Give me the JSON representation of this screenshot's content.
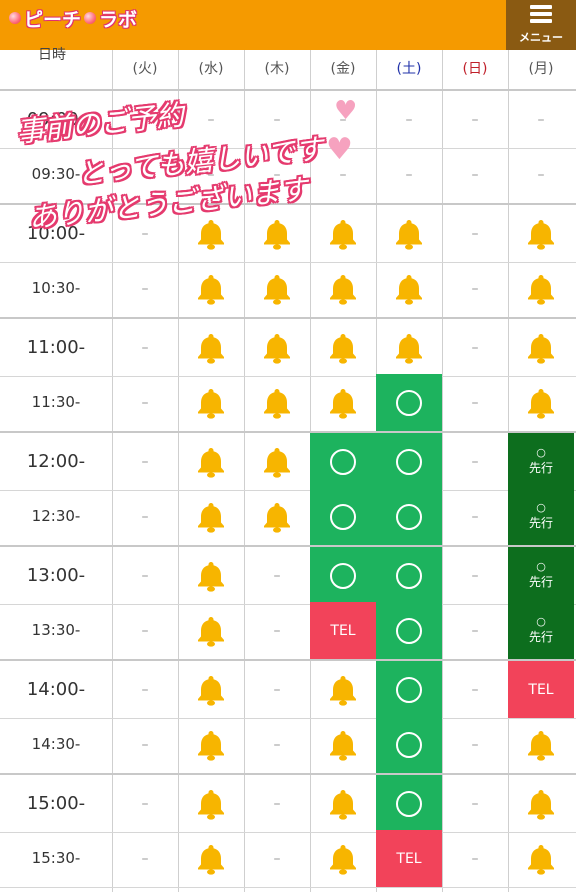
{
  "header": {
    "logo_left": "ピーチ",
    "logo_right": "ラボ",
    "menu_label": "メニュー"
  },
  "table": {
    "time_col_head": "日時",
    "days": [
      "(火)",
      "(水)",
      "(木)",
      "(金)",
      "(土)",
      "(日)",
      "(月)"
    ],
    "day_colors": [
      "#555555",
      "#555555",
      "#555555",
      "#555555",
      "#2233aa",
      "#c0202a",
      "#555555"
    ],
    "rows": [
      {
        "time": "09:00-",
        "cells": [
          "–",
          "–",
          "–",
          "–",
          "–",
          "–",
          "–"
        ]
      },
      {
        "time": "09:30-",
        "cells": [
          "–",
          "–",
          "–",
          "–",
          "–",
          "–",
          "–"
        ]
      },
      {
        "time": "10:00-",
        "cells": [
          "–",
          "bell",
          "bell",
          "bell",
          "bell",
          "–",
          "bell"
        ]
      },
      {
        "time": "10:30-",
        "cells": [
          "–",
          "bell",
          "bell",
          "bell",
          "bell",
          "–",
          "bell"
        ]
      },
      {
        "time": "11:00-",
        "cells": [
          "–",
          "bell",
          "bell",
          "bell",
          "bell",
          "–",
          "bell"
        ]
      },
      {
        "time": "11:30-",
        "cells": [
          "–",
          "bell",
          "bell",
          "bell",
          "open",
          "–",
          "bell"
        ]
      },
      {
        "time": "12:00-",
        "cells": [
          "–",
          "bell",
          "bell",
          "open",
          "open",
          "–",
          "pre"
        ]
      },
      {
        "time": "12:30-",
        "cells": [
          "–",
          "bell",
          "bell",
          "open",
          "open",
          "–",
          "pre"
        ]
      },
      {
        "time": "13:00-",
        "cells": [
          "–",
          "bell",
          "–",
          "open",
          "open",
          "–",
          "pre"
        ]
      },
      {
        "time": "13:30-",
        "cells": [
          "–",
          "bell",
          "–",
          "tel",
          "open",
          "–",
          "pre"
        ]
      },
      {
        "time": "14:00-",
        "cells": [
          "–",
          "bell",
          "–",
          "bell",
          "open",
          "–",
          "tel"
        ]
      },
      {
        "time": "14:30-",
        "cells": [
          "–",
          "bell",
          "–",
          "bell",
          "open",
          "–",
          "bell"
        ]
      },
      {
        "time": "15:00-",
        "cells": [
          "–",
          "bell",
          "–",
          "bell",
          "open",
          "–",
          "bell"
        ]
      },
      {
        "time": "15:30-",
        "cells": [
          "–",
          "bell",
          "–",
          "bell",
          "tel",
          "–",
          "bell"
        ]
      }
    ],
    "tel_label": "TEL",
    "pre_mark": "○",
    "pre_label": "先行"
  },
  "overlay": {
    "line1": "事前のご予約",
    "line2": "とっても嬉しいです",
    "line3": "ありがとうございます"
  },
  "colors": {
    "topbar": "#f59a00",
    "open": "#1db35e",
    "tel": "#f2435a",
    "pre": "#0d6e1e",
    "bell": "#f7b500"
  },
  "icons": {
    "bell": "bell-icon",
    "circle": "circle-icon",
    "menu": "hamburger-icon",
    "heart": "heart-icon"
  }
}
